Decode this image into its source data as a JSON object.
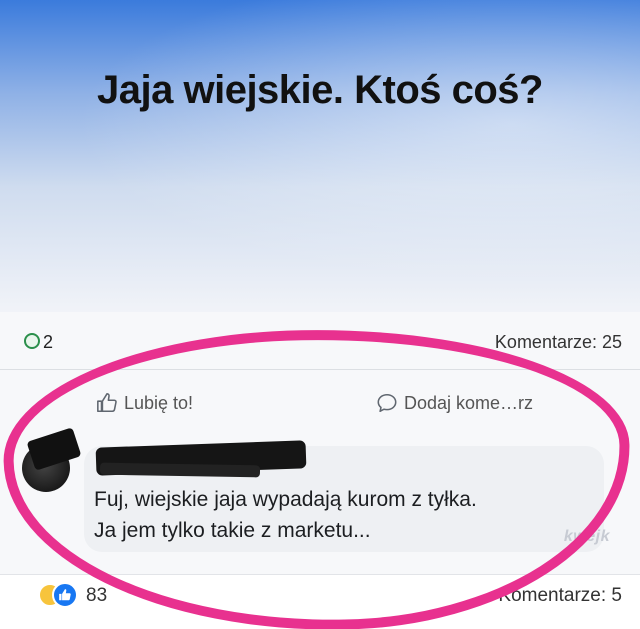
{
  "post": {
    "text": "Jaja wiejskie. Ktoś coś?",
    "reaction_count": "2",
    "comments_count": "Komentarze: 25"
  },
  "actions": {
    "like_label": "Lubię to!",
    "comment_label": "Dodaj kome…rz"
  },
  "comment": {
    "text": "Fuj, wiejskie jaja wypadają kurom z tyłka.\nJa jem tylko takie z marketu...",
    "watermark": "kwejk"
  },
  "footer": {
    "reaction_count": "83",
    "comments_count": "Komentarze: 5"
  },
  "colors": {
    "highlight": "#e8318f",
    "like_blue": "#1877f2"
  },
  "icons": [
    "reaction-icon",
    "like-thumb-icon",
    "comment-bubble-icon",
    "emoji-icon",
    "like-badge-icon"
  ]
}
